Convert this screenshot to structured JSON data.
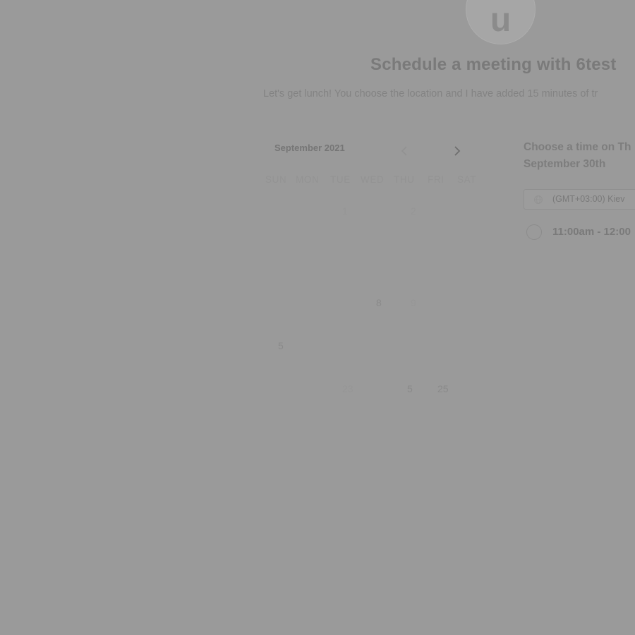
{
  "header": {
    "avatar_letter": "u",
    "title": "Schedule a meeting with 6test",
    "subtitle": "Let's get lunch! You choose the location and I have added 15 minutes of tr"
  },
  "calendar": {
    "month_label": "September 2021",
    "weekdays": [
      "SUN",
      "MON",
      "TUE",
      "WED",
      "THU",
      "FRI",
      "SAT"
    ],
    "visible_day_numbers": [
      "1",
      "2",
      "8",
      "9",
      "5",
      "23",
      "5",
      "25"
    ]
  },
  "time_panel": {
    "heading": "Choose a time on Th September 30th",
    "heading_line1": "Choose a time on Th",
    "heading_line2": "September 30th",
    "timezone": "(GMT+03:00) Kiev",
    "slots": [
      "11:00am - 12:00"
    ]
  },
  "icons": {
    "prev": "chevron-left-icon",
    "next": "chevron-right-icon",
    "timezone": "globe-icon"
  },
  "colors": {
    "overlay_background": "#9a9a9a"
  }
}
